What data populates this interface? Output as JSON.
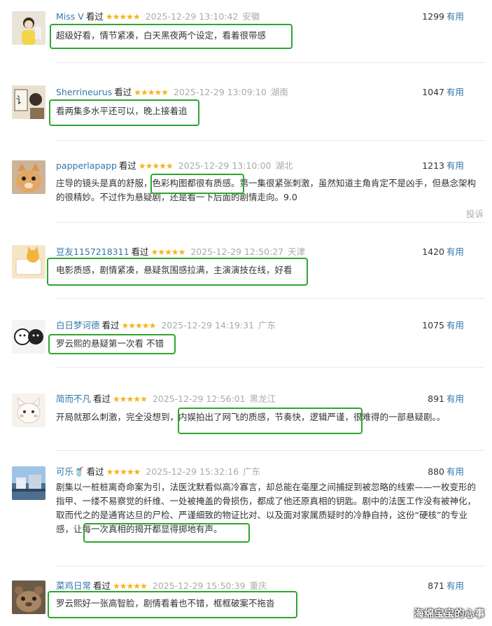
{
  "reviews": [
    {
      "username": "Miss V",
      "watched": "看过",
      "stars": "★★★★★",
      "time": "2025-12-29 13:10:42",
      "location": "安徽",
      "votes": "1299",
      "useful": "有用",
      "content": "超级好看，情节紧凑，白天黑夜两个设定，看着很带感"
    },
    {
      "username": "Sherrineurus",
      "watched": "看过",
      "stars": "★★★★★",
      "time": "2025-12-29 13:09:10",
      "location": "湖南",
      "votes": "1047",
      "useful": "有用",
      "content": "看两集多水平还可以，晚上接着追"
    },
    {
      "username": "papperlapapp",
      "watched": "看过",
      "stars": "★★★★★",
      "time": "2025-12-29 13:10:00",
      "location": "湖北",
      "votes": "1213",
      "useful": "有用",
      "content_a": "庄导的镜头是真的舒服，",
      "content_b": "色彩构图都很有质感",
      "content_c": "。第一集很紧张刺激，虽然知道主角肯定不是凶手，但悬念架构的很精妙。不过作为悬疑剧，还是看一下后面的剧情走向。9.0",
      "report": "投诉"
    },
    {
      "username": "豆友1157218311",
      "watched": "看过",
      "stars": "★★★★★",
      "time": "2025-12-29 12:50:27",
      "location": "天津",
      "votes": "1420",
      "useful": "有用",
      "content": "电影质感，剧情紧凑，悬疑氛围感拉满，主演演技在线，好看"
    },
    {
      "username": "白日梦诃德",
      "watched": "看过",
      "stars": "★★★★★",
      "time": "2025-12-29 14:19:31",
      "location": "广东",
      "votes": "1075",
      "useful": "有用",
      "content": "罗云熙的悬疑第一次看 不错"
    },
    {
      "username": "简而不凡",
      "watched": "看过",
      "stars": "★★★★★",
      "time": "2025-12-29 12:56:01",
      "location": "黑龙江",
      "votes": "891",
      "useful": "有用",
      "content_a": "开局就那么刺激，完全没想到，",
      "content_b": "内娱拍出了网飞的质感，节奏快，逻辑严谨，",
      "content_c": "很难得的一部悬疑剧。。"
    },
    {
      "username": "可乐🥤",
      "watched": "看过",
      "stars": "★★★★★",
      "time": "2025-12-29 15:32:16",
      "location": "广东",
      "votes": "880",
      "useful": "有用",
      "content": "剧集以一桩桩离奇命案为引，法医沈默看似高冷寡言，却总能在毫厘之间捕捉到被忽略的线索——一枚变形的指甲、一缕不易察觉的纤维、一处被掩盖的骨损伤，都成了他还原真相的钥匙。剧中的法医工作没有被神化，取而代之的是通宵达旦的尸检、严谨细致的物证比对、以及面对家属质疑时的冷静自持，这份“硬核”的专业感，让每一次真相的揭开都显得掷地有声。"
    },
    {
      "username": "菜鸡日常",
      "watched": "看过",
      "stars": "★★★★★",
      "time": "2025-12-29 15:50:39",
      "location": "重庆",
      "votes": "871",
      "useful": "有用",
      "content": "罗云熙好一张高智脸，剧情看着也不错，框框破案不拖沓"
    }
  ],
  "watermark": "海绵宝宝的心事",
  "colors": {
    "link": "#3377aa",
    "star": "#f5b31b",
    "highlight_box": "#2ea62e",
    "meta": "#aaaaaa"
  }
}
